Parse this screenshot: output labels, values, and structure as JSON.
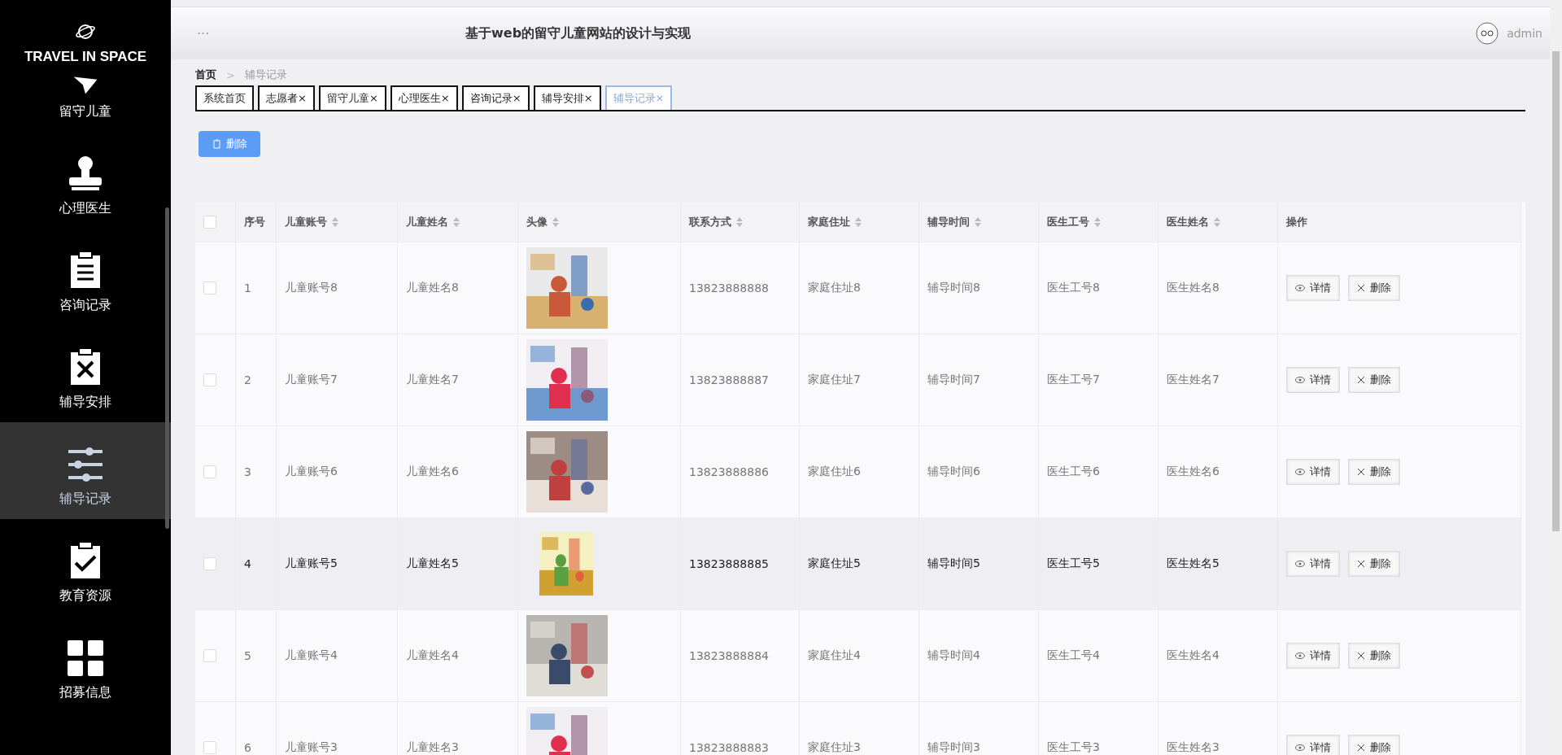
{
  "sidebar": {
    "logo_text": "TRAVEL IN SPACE",
    "items": [
      {
        "label": "留守儿童",
        "selected": false
      },
      {
        "label": "心理医生",
        "selected": false
      },
      {
        "label": "咨询记录",
        "selected": false
      },
      {
        "label": "辅导安排",
        "selected": false
      },
      {
        "label": "辅导记录",
        "selected": true
      },
      {
        "label": "教育资源",
        "selected": false
      },
      {
        "label": "招募信息",
        "selected": false
      }
    ]
  },
  "header": {
    "menu": "···",
    "title": "基于web的留守儿童网站的设计与实现",
    "user": "admin"
  },
  "breadcrumb": {
    "items": [
      "首页",
      "辅导记录"
    ],
    "separator": ">"
  },
  "tabs": [
    {
      "label": "系统首页",
      "closable": false,
      "selected": false
    },
    {
      "label": "志愿者",
      "closable": true,
      "selected": false
    },
    {
      "label": "留守儿童",
      "closable": true,
      "selected": false
    },
    {
      "label": "心理医生",
      "closable": true,
      "selected": false
    },
    {
      "label": "咨询记录",
      "closable": true,
      "selected": false
    },
    {
      "label": "辅导安排",
      "closable": true,
      "selected": false
    },
    {
      "label": "辅导记录",
      "closable": true,
      "selected": true
    }
  ],
  "close_mark": "×",
  "toolbar": {
    "delete_label": "删除"
  },
  "table": {
    "select_all": false,
    "columns": [
      {
        "label": "序号",
        "sortable": false
      },
      {
        "label": "儿童账号",
        "sortable": true
      },
      {
        "label": "儿童姓名",
        "sortable": true
      },
      {
        "label": "头像",
        "sortable": true
      },
      {
        "label": "联系方式",
        "sortable": true
      },
      {
        "label": "家庭住址",
        "sortable": true
      },
      {
        "label": "辅导时间",
        "sortable": true
      },
      {
        "label": "医生工号",
        "sortable": true
      },
      {
        "label": "医生姓名",
        "sortable": true
      },
      {
        "label": "操作",
        "sortable": false
      }
    ],
    "rows": [
      {
        "checked": false,
        "hovered": false,
        "cells": [
          "1",
          "儿童账号8",
          "儿童姓名8",
          {
            "kind": "picture"
          },
          "13823888888",
          "家庭住址8",
          "辅导时间8",
          "医生工号8",
          "医生姓名8",
          [
            "详情",
            "删除"
          ]
        ]
      },
      {
        "checked": false,
        "hovered": false,
        "cells": [
          "2",
          "儿童账号7",
          "儿童姓名7",
          {
            "kind": "picture"
          },
          "13823888887",
          "家庭住址7",
          "辅导时间7",
          "医生工号7",
          "医生姓名7",
          [
            "详情",
            "删除"
          ]
        ]
      },
      {
        "checked": false,
        "hovered": false,
        "cells": [
          "3",
          "儿童账号6",
          "儿童姓名6",
          {
            "kind": "picture"
          },
          "13823888886",
          "家庭住址6",
          "辅导时间6",
          "医生工号6",
          "医生姓名6",
          [
            "详情",
            "删除"
          ]
        ]
      },
      {
        "checked": false,
        "hovered": true,
        "cells": [
          "4",
          "儿童账号5",
          "儿童姓名5",
          {
            "kind": "picture"
          },
          "13823888885",
          "家庭住址5",
          "辅导时间5",
          "医生工号5",
          "医生姓名5",
          [
            "详情",
            "删除"
          ]
        ]
      },
      {
        "checked": false,
        "hovered": false,
        "cells": [
          "5",
          "儿童账号4",
          "儿童姓名4",
          {
            "kind": "picture"
          },
          "13823888884",
          "家庭住址4",
          "辅导时间4",
          "医生工号4",
          "医生姓名4",
          [
            "详情",
            "删除"
          ]
        ]
      },
      {
        "checked": false,
        "hovered": false,
        "cells": [
          "6",
          "儿童账号3",
          "儿童姓名3",
          {
            "kind": "picture"
          },
          "13823888883",
          "家庭住址3",
          "辅导时间3",
          "医生工号3",
          "医生姓名3",
          [
            "详情",
            "删除"
          ]
        ]
      }
    ]
  }
}
